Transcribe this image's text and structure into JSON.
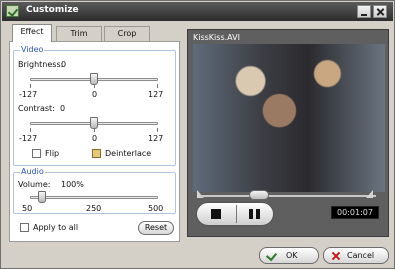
{
  "window": {
    "title": "Customize"
  },
  "tabs": [
    {
      "label": "Effect",
      "active": true
    },
    {
      "label": "Trim",
      "active": false
    },
    {
      "label": "Crop",
      "active": false
    }
  ],
  "video_group": {
    "legend": "Video",
    "brightness": {
      "label": "Brightness:",
      "value": "0",
      "min": "-127",
      "mid": "0",
      "max": "127",
      "position": 0.5
    },
    "contrast": {
      "label": "Contrast:",
      "value": "0",
      "min": "-127",
      "mid": "0",
      "max": "127",
      "position": 0.5
    },
    "flip": {
      "label": "Flip",
      "checked": false
    },
    "deinterlace": {
      "label": "Deinterlace",
      "checked": true
    }
  },
  "audio_group": {
    "legend": "Audio",
    "volume": {
      "label": "Volume:",
      "value": "100%",
      "min": "50",
      "mid": "250",
      "max": "500",
      "position": 0.11
    }
  },
  "apply_to_all": {
    "label": "Apply to all",
    "checked": false
  },
  "reset_label": "Reset",
  "preview": {
    "filename": "KissKiss.AVI",
    "time": "00:01:07",
    "seek_position": 0.33
  },
  "footer": {
    "ok_label": "OK",
    "cancel_label": "Cancel"
  },
  "icons": {
    "app": "check-app-icon",
    "ok": "check-icon",
    "cancel": "x-icon",
    "stop": "stop-icon",
    "pause": "pause-icon"
  }
}
